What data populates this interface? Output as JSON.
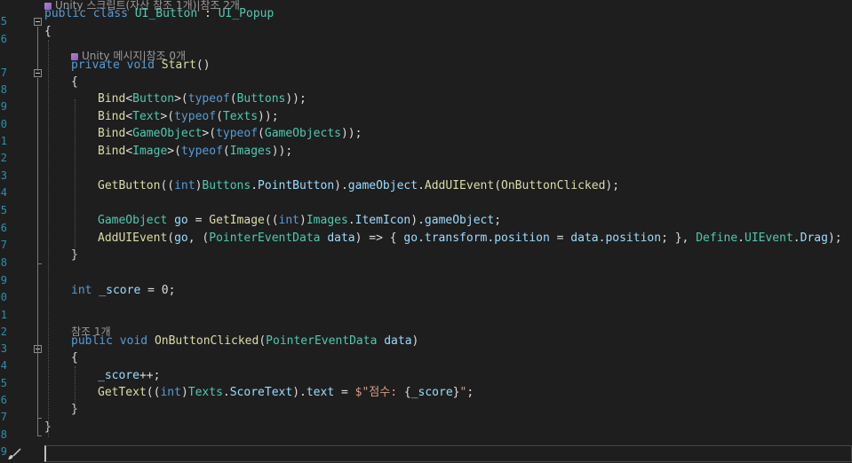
{
  "editor": {
    "theme_colors": {
      "keyword": "#569cd6",
      "type": "#4ec9b0",
      "method": "#dcdcaa",
      "identifier": "#9cdcfe",
      "plain": "#dcdcdc",
      "string": "#d69d85",
      "line_number": "#2b91af",
      "codelens": "#9a9a9a"
    },
    "line_numbers": [
      "5",
      "6",
      "7",
      "8",
      "9",
      "0",
      "1",
      "2",
      "3",
      "4",
      "5",
      "6",
      "7",
      "8",
      "9",
      "0",
      "1",
      "2",
      "3",
      "4",
      "5",
      "6",
      "7",
      "8",
      "9"
    ],
    "codelens": {
      "class": "Unity 스크립트(자산 참조 1개)|참조 2개",
      "start": "Unity 메시지|참조 0개",
      "onclick": "참조 1개"
    },
    "lines": [
      [
        [
          "kw",
          "public"
        ],
        [
          "pl",
          " "
        ],
        [
          "kw",
          "class"
        ],
        [
          "pl",
          " "
        ],
        [
          "ty",
          "UI_Button"
        ],
        [
          "pl",
          " : "
        ],
        [
          "ty",
          "UI_Popup"
        ]
      ],
      [
        [
          "pl",
          "{"
        ]
      ],
      [
        [
          "kw",
          "private"
        ],
        [
          "pl",
          " "
        ],
        [
          "kw",
          "void"
        ],
        [
          "pl",
          " "
        ],
        [
          "fn",
          "Start"
        ],
        [
          "pl",
          "()"
        ]
      ],
      [
        [
          "pl",
          "{"
        ]
      ],
      [
        [
          "fn",
          "Bind"
        ],
        [
          "pl",
          "<"
        ],
        [
          "ty",
          "Button"
        ],
        [
          "pl",
          ">("
        ],
        [
          "kw",
          "typeof"
        ],
        [
          "pl",
          "("
        ],
        [
          "ty",
          "Buttons"
        ],
        [
          "pl",
          "));"
        ]
      ],
      [
        [
          "fn",
          "Bind"
        ],
        [
          "pl",
          "<"
        ],
        [
          "ty",
          "Text"
        ],
        [
          "pl",
          ">("
        ],
        [
          "kw",
          "typeof"
        ],
        [
          "pl",
          "("
        ],
        [
          "ty",
          "Texts"
        ],
        [
          "pl",
          "));"
        ]
      ],
      [
        [
          "fn",
          "Bind"
        ],
        [
          "pl",
          "<"
        ],
        [
          "ty",
          "GameObject"
        ],
        [
          "pl",
          ">("
        ],
        [
          "kw",
          "typeof"
        ],
        [
          "pl",
          "("
        ],
        [
          "ty",
          "GameObjects"
        ],
        [
          "pl",
          "));"
        ]
      ],
      [
        [
          "fn",
          "Bind"
        ],
        [
          "pl",
          "<"
        ],
        [
          "ty",
          "Image"
        ],
        [
          "pl",
          ">("
        ],
        [
          "kw",
          "typeof"
        ],
        [
          "pl",
          "("
        ],
        [
          "ty",
          "Images"
        ],
        [
          "pl",
          "));"
        ]
      ],
      [],
      [
        [
          "fn",
          "GetButton"
        ],
        [
          "pl",
          "(("
        ],
        [
          "kw",
          "int"
        ],
        [
          "pl",
          ")"
        ],
        [
          "ty",
          "Buttons"
        ],
        [
          "pl",
          "."
        ],
        [
          "id",
          "PointButton"
        ],
        [
          "pl",
          ")."
        ],
        [
          "id",
          "gameObject"
        ],
        [
          "pl",
          "."
        ],
        [
          "fn",
          "AddUIEvent"
        ],
        [
          "pl",
          "("
        ],
        [
          "fn",
          "OnButtonClicked"
        ],
        [
          "pl",
          ");"
        ]
      ],
      [],
      [
        [
          "ty",
          "GameObject"
        ],
        [
          "pl",
          " "
        ],
        [
          "id",
          "go"
        ],
        [
          "pl",
          " = "
        ],
        [
          "fn",
          "GetImage"
        ],
        [
          "pl",
          "(("
        ],
        [
          "kw",
          "int"
        ],
        [
          "pl",
          ")"
        ],
        [
          "ty",
          "Images"
        ],
        [
          "pl",
          "."
        ],
        [
          "id",
          "ItemIcon"
        ],
        [
          "pl",
          ")."
        ],
        [
          "id",
          "gameObject"
        ],
        [
          "pl",
          ";"
        ]
      ],
      [
        [
          "fn",
          "AddUIEvent"
        ],
        [
          "pl",
          "("
        ],
        [
          "id",
          "go"
        ],
        [
          "pl",
          ", ("
        ],
        [
          "ty",
          "PointerEventData"
        ],
        [
          "pl",
          " "
        ],
        [
          "id",
          "data"
        ],
        [
          "pl",
          ") => { "
        ],
        [
          "id",
          "go"
        ],
        [
          "pl",
          "."
        ],
        [
          "id",
          "transform"
        ],
        [
          "pl",
          "."
        ],
        [
          "id",
          "position"
        ],
        [
          "pl",
          " = "
        ],
        [
          "id",
          "data"
        ],
        [
          "pl",
          "."
        ],
        [
          "id",
          "position"
        ],
        [
          "pl",
          "; }, "
        ],
        [
          "ty",
          "Define"
        ],
        [
          "pl",
          "."
        ],
        [
          "ty",
          "UIEvent"
        ],
        [
          "pl",
          "."
        ],
        [
          "id",
          "Drag"
        ],
        [
          "pl",
          ");"
        ]
      ],
      [
        [
          "pl",
          "}"
        ]
      ],
      [],
      [
        [
          "kw",
          "int"
        ],
        [
          "pl",
          " "
        ],
        [
          "id",
          "_score"
        ],
        [
          "pl",
          " = "
        ],
        [
          "pl",
          "0"
        ],
        [
          "pl",
          ";"
        ]
      ],
      [
        [
          "kw",
          "public"
        ],
        [
          "pl",
          " "
        ],
        [
          "kw",
          "void"
        ],
        [
          "pl",
          " "
        ],
        [
          "fn",
          "OnButtonClicked"
        ],
        [
          "pl",
          "("
        ],
        [
          "ty",
          "PointerEventData"
        ],
        [
          "pl",
          " "
        ],
        [
          "id",
          "data"
        ],
        [
          "pl",
          ")"
        ]
      ],
      [
        [
          "pl",
          "{"
        ]
      ],
      [
        [
          "id",
          "_score"
        ],
        [
          "pl",
          "++;"
        ]
      ],
      [
        [
          "fn",
          "GetText"
        ],
        [
          "pl",
          "(("
        ],
        [
          "kw",
          "int"
        ],
        [
          "pl",
          ")"
        ],
        [
          "ty",
          "Texts"
        ],
        [
          "pl",
          "."
        ],
        [
          "id",
          "ScoreText"
        ],
        [
          "pl",
          ")."
        ],
        [
          "id",
          "text"
        ],
        [
          "pl",
          " = "
        ],
        [
          "st",
          "$\"점수: "
        ],
        [
          "pl",
          "{"
        ],
        [
          "id",
          "_score"
        ],
        [
          "pl",
          "}"
        ],
        [
          "st",
          "\""
        ],
        [
          "pl",
          ";"
        ]
      ],
      [
        [
          "pl",
          "}"
        ]
      ],
      [
        [
          "pl",
          "}"
        ]
      ]
    ]
  }
}
